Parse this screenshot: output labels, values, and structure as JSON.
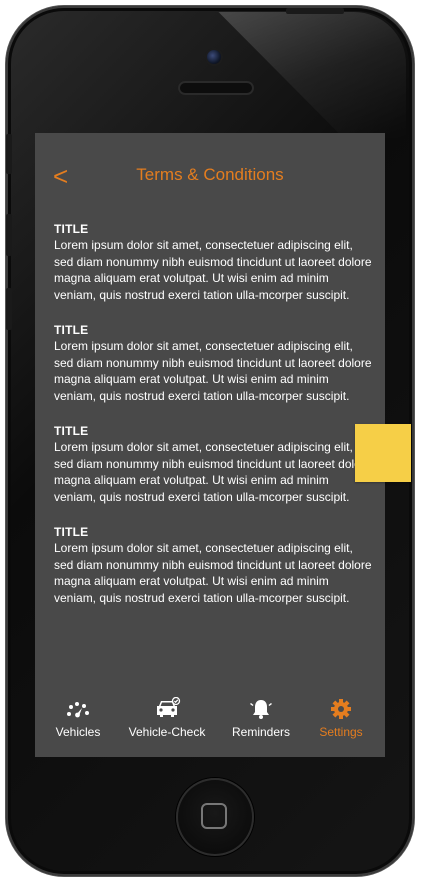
{
  "header": {
    "back_label": "<",
    "title": "Terms & Conditions"
  },
  "sections": [
    {
      "heading": "TITLE",
      "body": "Lorem ipsum dolor sit amet, consectetuer adipiscing elit, sed diam nonummy nibh euismod tincidunt ut laoreet dolore magna aliquam erat volutpat. Ut wisi enim ad minim veniam, quis nostrud exerci tation ulla-mcorper suscipit."
    },
    {
      "heading": "TITLE",
      "body": "Lorem ipsum dolor sit amet, consectetuer adipiscing elit, sed diam nonummy nibh euismod tincidunt ut laoreet dolore magna aliquam erat volutpat. Ut wisi enim ad minim veniam, quis nostrud exerci tation ulla-mcorper suscipit."
    },
    {
      "heading": "TITLE",
      "body": "Lorem ipsum dolor sit amet, consectetuer adipiscing elit, sed diam nonummy nibh euismod tincidunt ut laoreet dolore magna aliquam erat volutpat. Ut wisi enim ad minim veniam, quis nostrud exerci tation ulla-mcorper suscipit."
    },
    {
      "heading": "TITLE",
      "body": "Lorem ipsum dolor sit amet, consectetuer adipiscing elit, sed diam nonummy nibh euismod tincidunt ut laoreet dolore magna aliquam erat volutpat. Ut wisi enim ad minim veniam, quis nostrud exerci tation ulla-mcorper suscipit."
    }
  ],
  "tabbar": {
    "tabs": [
      {
        "label": "Vehicles",
        "icon": "speedometer-icon",
        "active": false
      },
      {
        "label": "Vehicle-Check",
        "icon": "car-check-icon",
        "active": false
      },
      {
        "label": "Reminders",
        "icon": "bell-icon",
        "active": false
      },
      {
        "label": "Settings",
        "icon": "gear-icon",
        "active": true
      }
    ]
  },
  "colors": {
    "accent": "#e47d1f",
    "screen_bg": "#494949",
    "text": "#ffffff",
    "sticky_note": "#f6cf47"
  }
}
